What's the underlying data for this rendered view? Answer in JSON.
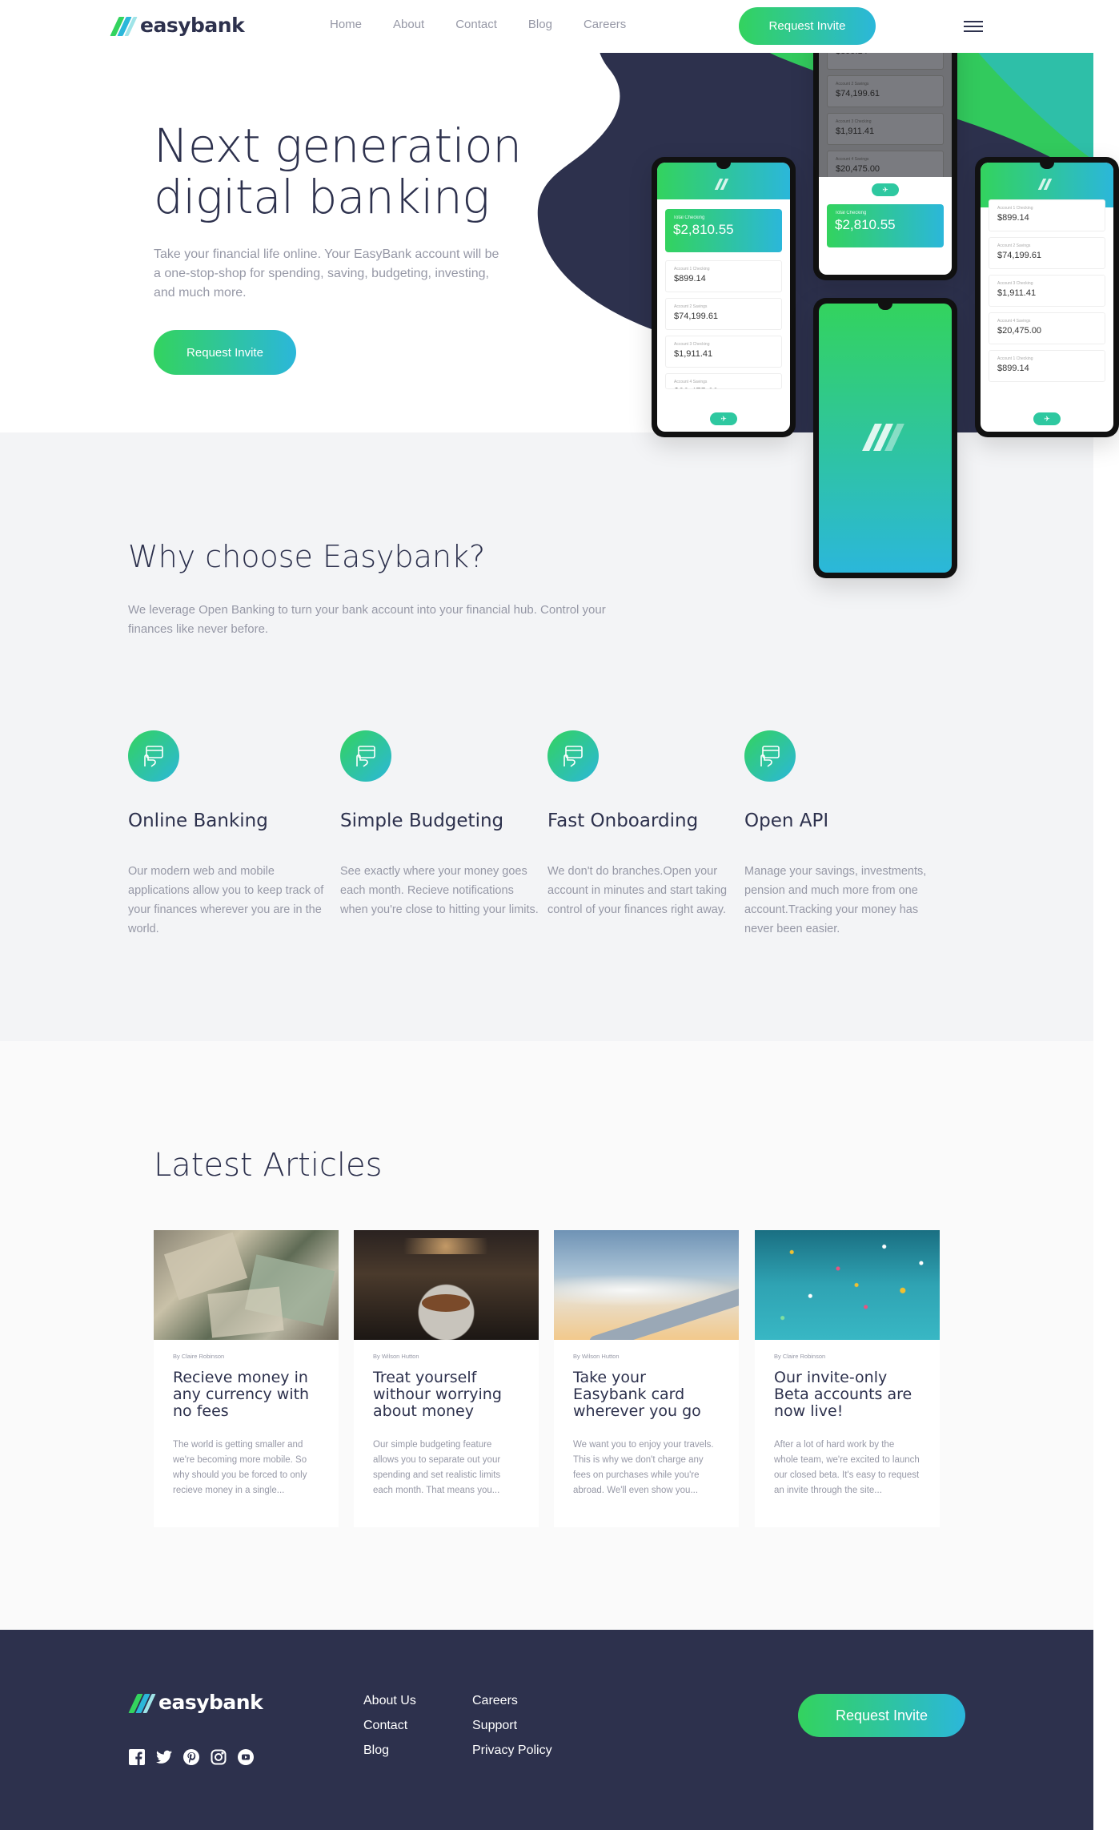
{
  "brand": {
    "name": "easybank"
  },
  "nav": [
    "Home",
    "About",
    "Contact",
    "Blog",
    "Careers"
  ],
  "header": {
    "cta": "Request Invite"
  },
  "hero": {
    "title_line1": "Next generation",
    "title_line2": "digital banking",
    "text": "Take your financial life online. Your EasyBank account will be a one-stop-shop for spending, saving, budgeting, investing, and much more.",
    "cta": "Request Invite"
  },
  "phones": {
    "total_label": "Total Checking",
    "total": "$2,810.55",
    "accounts": [
      {
        "label": "Account 1 Checking",
        "value": "$899.14"
      },
      {
        "label": "Account 2 Savings",
        "value": "$74,199.61"
      },
      {
        "label": "Account 3 Checking",
        "value": "$1,911.41"
      },
      {
        "label": "Account 4 Savings",
        "value": "$20,475.00"
      },
      {
        "label": "Account 1 Checking",
        "value": "$899.14"
      }
    ]
  },
  "why": {
    "title": "Why choose Easybank?",
    "text": "We leverage Open Banking to turn your bank account into your financial hub. Control your finances like never before.",
    "features": [
      {
        "title": "Online Banking",
        "text": "Our modern web and mobile applications allow you to keep track of your finances wherever you are in the world."
      },
      {
        "title": "Simple Budgeting",
        "text": "See exactly where your money goes each month. Recieve notifications when you're close to hitting your limits."
      },
      {
        "title": "Fast Onboarding",
        "text": "We don't do branches.Open your account in minutes and start taking control of your finances right away."
      },
      {
        "title": "Open API",
        "text": "Manage your savings, investments, pension and much more from one account.Tracking your money has never been easier."
      }
    ]
  },
  "articles": {
    "title": "Latest Articles",
    "items": [
      {
        "by": "By Claire Robinson",
        "title": "Recieve money in any currency with no fees",
        "text": "The world is getting smaller and we're becoming more mobile. So why should you be forced to only recieve money in a single..."
      },
      {
        "by": "By Wilson Hutton",
        "title": "Treat yourself withour worrying about money",
        "text": "Our simple budgeting feature allows you to separate out your spending and set realistic limits each month. That means you..."
      },
      {
        "by": "By Wilson Hutton",
        "title": "Take your Easybank card wherever you go",
        "text": "We want you to enjoy your travels. This is why we don't charge any fees on purchases while you're abroad. We'll even show you..."
      },
      {
        "by": "By Claire Robinson",
        "title": "Our invite-only Beta accounts are now live!",
        "text": "After a lot of hard work by the whole team, we're excited to launch our closed beta. It's easy to request an invite through the site..."
      }
    ]
  },
  "footer": {
    "links_col1": [
      "About Us",
      "Contact",
      "Blog"
    ],
    "links_col2": [
      "Careers",
      "Support",
      "Privacy Policy"
    ],
    "cta": "Request Invite",
    "social": [
      "facebook-icon",
      "twitter-icon",
      "pinterest-icon",
      "instagram-icon",
      "youtube-icon"
    ]
  },
  "colors": {
    "dark_blue": "#2d314d",
    "green": "#33d35e",
    "cyan": "#2bb7da",
    "gray_text": "#9698a6",
    "light_bg": "#f3f4f6"
  }
}
